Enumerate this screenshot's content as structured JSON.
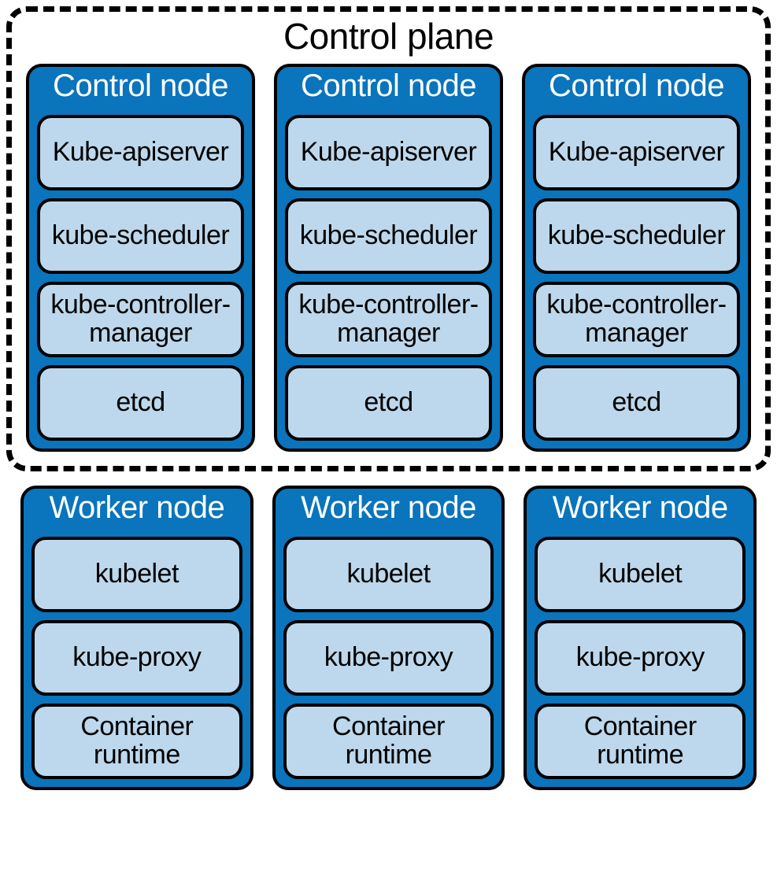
{
  "control_plane": {
    "title": "Control plane",
    "nodes": [
      {
        "title": "Control node",
        "components": [
          "Kube-apiserver",
          "kube-scheduler",
          "kube-controller-manager",
          "etcd"
        ]
      },
      {
        "title": "Control node",
        "components": [
          "Kube-apiserver",
          "kube-scheduler",
          "kube-controller-manager",
          "etcd"
        ]
      },
      {
        "title": "Control node",
        "components": [
          "Kube-apiserver",
          "kube-scheduler",
          "kube-controller-manager",
          "etcd"
        ]
      }
    ]
  },
  "workers": [
    {
      "title": "Worker node",
      "components": [
        "kubelet",
        "kube-proxy",
        "Container runtime"
      ]
    },
    {
      "title": "Worker node",
      "components": [
        "kubelet",
        "kube-proxy",
        "Container runtime"
      ]
    },
    {
      "title": "Worker node",
      "components": [
        "kubelet",
        "kube-proxy",
        "Container runtime"
      ]
    }
  ]
}
